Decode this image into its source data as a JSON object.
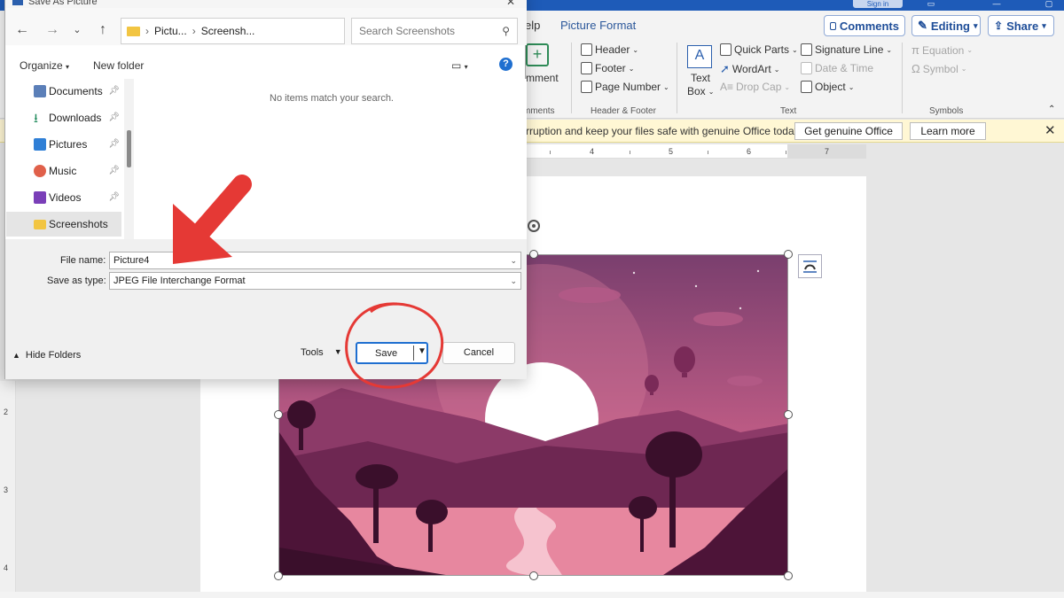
{
  "word": {
    "signin": "Sign in",
    "tabs": {
      "help": "elp",
      "picture_format": "Picture Format"
    },
    "top_buttons": {
      "comments": "Comments",
      "editing": "Editing",
      "share": "Share"
    },
    "ribbon": {
      "comment_fragment": "mment",
      "comments_group_fragment": "mments",
      "header": "Header",
      "footer": "Footer",
      "page_number": "Page Number",
      "header_footer_group": "Header & Footer",
      "text_box_line1": "Text",
      "text_box_line2": "Box",
      "quick_parts": "Quick Parts",
      "wordart": "WordArt",
      "drop_cap": "Drop Cap",
      "signature_line": "Signature Line",
      "date_time": "Date & Time",
      "object": "Object",
      "text_group": "Text",
      "equation": "Equation",
      "symbol": "Symbol",
      "symbols_group": "Symbols"
    },
    "infobar": {
      "message": "rruption and keep your files safe with genuine Office today.",
      "get_genuine": "Get genuine Office",
      "learn_more": "Learn more"
    },
    "ruler_numbers": [
      "4",
      "5",
      "6",
      "7"
    ],
    "vruler_numbers": [
      "2",
      "3",
      "4"
    ]
  },
  "dialog": {
    "title": "Save As Picture",
    "breadcrumb": {
      "part1": "Pictu...",
      "part2": "Screensh..."
    },
    "search_placeholder": "Search Screenshots",
    "organize": "Organize",
    "new_folder": "New folder",
    "help": "?",
    "nav_items": [
      {
        "label": "Documents",
        "icon": "documents-icon",
        "color": "#5b7fb8"
      },
      {
        "label": "Downloads",
        "icon": "downloads-icon",
        "color": "#1f8a5b"
      },
      {
        "label": "Pictures",
        "icon": "pictures-icon",
        "color": "#2f7fd6"
      },
      {
        "label": "Music",
        "icon": "music-icon",
        "color": "#e0604a"
      },
      {
        "label": "Videos",
        "icon": "videos-icon",
        "color": "#7a3fb8"
      },
      {
        "label": "Screenshots",
        "icon": "folder-icon",
        "color": "#f2c542"
      }
    ],
    "empty_message": "No items match your search.",
    "file_name_label": "File name:",
    "file_name_value": "Picture4",
    "save_type_label": "Save as type:",
    "save_type_value": "JPEG File Interchange Format",
    "hide_folders": "Hide Folders",
    "tools": "Tools",
    "save": "Save",
    "cancel": "Cancel"
  },
  "colors": {
    "word_blue": "#1e5bb8",
    "accent": "#1f6fd0",
    "annotation_red": "#e53935"
  }
}
